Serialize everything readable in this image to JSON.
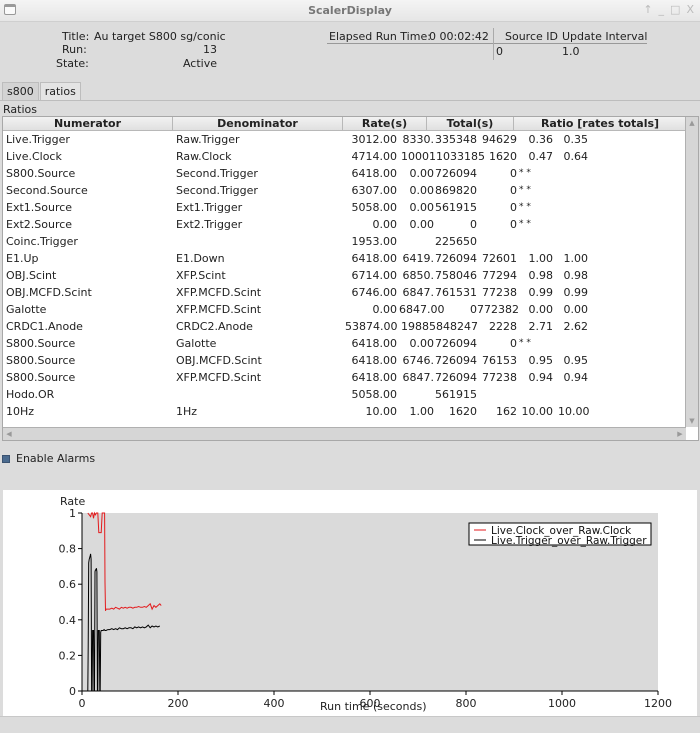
{
  "window": {
    "title": "ScalerDisplay",
    "controls": [
      "↑",
      "_",
      "□",
      "X"
    ]
  },
  "header": {
    "title_label": "Title:",
    "title_value": "Au target S800 sg/conic",
    "run_label": "Run:",
    "run_value": "13",
    "state_label": "State:",
    "state_value": "Active",
    "elapsed_label": "Elapsed Run Time:",
    "elapsed_value": "0 00:02:42",
    "source_id_label": "Source ID",
    "source_id_value": "0",
    "update_interval_label": "Update Interval",
    "update_interval_value": "1.0"
  },
  "tabs": [
    {
      "label": "s800"
    },
    {
      "label": "ratios",
      "active": true
    }
  ],
  "panel_label": "Ratios",
  "table": {
    "columns": [
      "Numerator",
      "Denominator",
      "Rate(s)",
      "Total(s)",
      "Ratio [rates totals]"
    ],
    "rows": [
      {
        "num": "Live.Trigger",
        "den": "Raw.Trigger",
        "rate1": "3012.00",
        "rate2": "8330.",
        "tot1": "335348",
        "tot2": "94629",
        "r1": "0.36",
        "r2": "0.35"
      },
      {
        "num": "Live.Clock",
        "den": "Raw.Clock",
        "rate1": "4714.00",
        "rate2": "100011033185",
        "tot1": "",
        "tot2": "1620",
        "r1": "0.47",
        "r2": "0.64"
      },
      {
        "num": "S800.Source",
        "den": "Second.Trigger",
        "rate1": "6418.00",
        "rate2": "0.00",
        "tot1": "726094",
        "tot2": "0",
        "r1": "* *",
        "r2": ""
      },
      {
        "num": "Second.Source",
        "den": "Second.Trigger",
        "rate1": "6307.00",
        "rate2": "0.00",
        "tot1": "869820",
        "tot2": "0",
        "r1": "* *",
        "r2": ""
      },
      {
        "num": "Ext1.Source",
        "den": "Ext1.Trigger",
        "rate1": "5058.00",
        "rate2": "0.00",
        "tot1": "561915",
        "tot2": "0",
        "r1": "* *",
        "r2": ""
      },
      {
        "num": "Ext2.Source",
        "den": "Ext2.Trigger",
        "rate1": "0.00",
        "rate2": "0.00",
        "tot1": "0",
        "tot2": "0",
        "r1": "* *",
        "r2": ""
      },
      {
        "num": "Coinc.Trigger",
        "den": "",
        "rate1": "1953.00",
        "rate2": "",
        "tot1": "225650",
        "tot2": "",
        "r1": "",
        "r2": ""
      },
      {
        "num": "E1.Up",
        "den": "E1.Down",
        "rate1": "6418.00",
        "rate2": "6419.",
        "tot1": "726094",
        "tot2": "72601",
        "r1": "1.00",
        "r2": "1.00"
      },
      {
        "num": "OBJ.Scint",
        "den": "XFP.Scint",
        "rate1": "6714.00",
        "rate2": "6850.",
        "tot1": "758046",
        "tot2": "77294",
        "r1": "0.98",
        "r2": "0.98"
      },
      {
        "num": "OBJ.MCFD.Scint",
        "den": "XFP.MCFD.Scint",
        "rate1": "6746.00",
        "rate2": "6847.",
        "tot1": "761531",
        "tot2": "77238",
        "r1": "0.99",
        "r2": "0.99"
      },
      {
        "num": "Galotte",
        "den": "XFP.MCFD.Scint",
        "rate1": "0.00",
        "rate2": "6847.00",
        "tot1": "0",
        "tot2": "772382",
        "r1": "0.00",
        "r2": "0.00"
      },
      {
        "num": "CRDC1.Anode",
        "den": "CRDC2.Anode",
        "rate1": "53874.00",
        "rate2": "19885848247",
        "tot1": "",
        "tot2": "2228",
        "r1": "2.71",
        "r2": "2.62"
      },
      {
        "num": "S800.Source",
        "den": "Galotte",
        "rate1": "6418.00",
        "rate2": "0.00",
        "tot1": "726094",
        "tot2": "0",
        "r1": "* *",
        "r2": ""
      },
      {
        "num": "S800.Source",
        "den": "OBJ.MCFD.Scint",
        "rate1": "6418.00",
        "rate2": "6746.",
        "tot1": "726094",
        "tot2": "76153",
        "r1": "0.95",
        "r2": "0.95"
      },
      {
        "num": "S800.Source",
        "den": "XFP.MCFD.Scint",
        "rate1": "6418.00",
        "rate2": "6847.",
        "tot1": "726094",
        "tot2": "77238",
        "r1": "0.94",
        "r2": "0.94"
      },
      {
        "num": "Hodo.OR",
        "den": "",
        "rate1": "5058.00",
        "rate2": "",
        "tot1": "561915",
        "tot2": "",
        "r1": "",
        "r2": ""
      },
      {
        "num": "10Hz",
        "den": "1Hz",
        "rate1": "10.00",
        "rate2": "1.00",
        "tot1": "1620",
        "tot2": "162",
        "r1": "10.00",
        "r2": "10.00"
      }
    ]
  },
  "alarms": {
    "label": "Enable Alarms",
    "checked": true
  },
  "chart_data": {
    "type": "line",
    "title": "",
    "xlabel": "Run time (seconds)",
    "ylabel": "Rate",
    "xlim": [
      0,
      1200
    ],
    "ylim": [
      0,
      1
    ],
    "xticks": [
      0,
      200,
      400,
      600,
      800,
      1000,
      1200
    ],
    "yticks": [
      0,
      0.2,
      0.4,
      0.6,
      0.8,
      1
    ],
    "ytick_labels": [
      "0",
      "0.2",
      "0.4",
      "0.6",
      "0.8",
      "1"
    ],
    "legend_position": "top-right",
    "series": [
      {
        "name": "Live.Clock_over_Raw.Clock",
        "color": "#e31a1c",
        "x": [
          12,
          15,
          18,
          20,
          22,
          24,
          26,
          28,
          30,
          31,
          33,
          35,
          37,
          38,
          40,
          42,
          44,
          46,
          47,
          48,
          49,
          50,
          52,
          54,
          58,
          62,
          66,
          70,
          74,
          78,
          82,
          86,
          90,
          94,
          98,
          102,
          106,
          110,
          114,
          118,
          122,
          126,
          130,
          134,
          138,
          142,
          146,
          150,
          154,
          158,
          162,
          165
        ],
        "y": [
          1.0,
          0.99,
          0.98,
          1.0,
          1.0,
          0.97,
          1.0,
          0.99,
          1.0,
          1.0,
          1.0,
          0.89,
          0.89,
          0.89,
          0.89,
          1.0,
          1.0,
          1.0,
          1.0,
          0.61,
          0.45,
          0.46,
          0.46,
          0.46,
          0.46,
          0.465,
          0.46,
          0.47,
          0.465,
          0.46,
          0.47,
          0.465,
          0.47,
          0.465,
          0.47,
          0.47,
          0.465,
          0.47,
          0.47,
          0.475,
          0.47,
          0.47,
          0.475,
          0.47,
          0.48,
          0.49,
          0.46,
          0.48,
          0.47,
          0.48,
          0.49,
          0.48
        ]
      },
      {
        "name": "Live.Trigger_over_Raw.Trigger",
        "color": "#000000",
        "x": [
          12,
          13,
          14,
          15,
          17,
          18,
          19,
          20,
          21,
          22,
          23,
          24,
          25,
          26,
          27,
          28,
          29,
          30,
          31,
          32,
          33,
          34,
          35,
          36,
          37,
          38,
          39,
          40,
          41,
          42,
          44,
          46,
          48,
          50,
          54,
          58,
          62,
          66,
          70,
          74,
          78,
          82,
          86,
          90,
          94,
          98,
          102,
          106,
          110,
          114,
          118,
          122,
          126,
          130,
          134,
          138,
          142,
          146,
          150,
          154,
          158,
          162
        ],
        "y": [
          0.0,
          0.25,
          0.72,
          0.74,
          0.76,
          0.77,
          0.74,
          0.0,
          0.0,
          0.34,
          0.34,
          0.34,
          0.0,
          0.0,
          0.67,
          0.68,
          0.68,
          0.69,
          0.67,
          0.0,
          0.0,
          0.34,
          0.34,
          0.34,
          0.0,
          0.0,
          0.33,
          0.34,
          0.34,
          0.34,
          0.34,
          0.345,
          0.34,
          0.34,
          0.345,
          0.345,
          0.35,
          0.345,
          0.35,
          0.345,
          0.355,
          0.35,
          0.35,
          0.355,
          0.35,
          0.355,
          0.355,
          0.35,
          0.36,
          0.355,
          0.36,
          0.355,
          0.36,
          0.355,
          0.36,
          0.37,
          0.355,
          0.365,
          0.36,
          0.365,
          0.36,
          0.365
        ]
      }
    ]
  }
}
